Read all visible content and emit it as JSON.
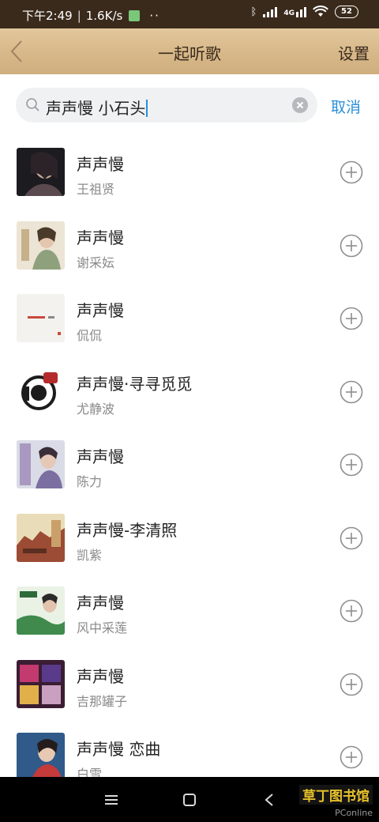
{
  "status_bar": {
    "time": "下午2:49",
    "speed": "1.6K/s",
    "dots": "··",
    "battery": "52"
  },
  "header": {
    "title": "一起听歌",
    "settings_label": "设置"
  },
  "search": {
    "query": "声声慢 小石头",
    "cancel_label": "取消"
  },
  "songs": [
    {
      "title": "声声慢",
      "artist": "王祖贤"
    },
    {
      "title": "声声慢",
      "artist": "谢采妘"
    },
    {
      "title": "声声慢",
      "artist": "侃侃"
    },
    {
      "title": "声声慢·寻寻觅觅",
      "artist": "尤静波"
    },
    {
      "title": "声声慢",
      "artist": "陈力"
    },
    {
      "title": "声声慢-李清照",
      "artist": "凯紫"
    },
    {
      "title": "声声慢",
      "artist": "风中采莲"
    },
    {
      "title": "声声慢",
      "artist": "吉那罐子"
    },
    {
      "title": "声声慢 恋曲",
      "artist": "白雪"
    }
  ],
  "icons": {
    "back": "chevron-left-icon",
    "search": "search-icon",
    "clear": "clear-icon",
    "add": "add-circle-icon",
    "menu": "menu-icon",
    "home": "home-icon",
    "nav_back": "back-triangle-icon"
  },
  "colors": {
    "accent": "#2a8fd8",
    "header_bg": "#d8b98a",
    "status_bg": "#3a2a1c"
  },
  "watermark": {
    "text": "草丁图书馆",
    "sub": "PConline"
  }
}
